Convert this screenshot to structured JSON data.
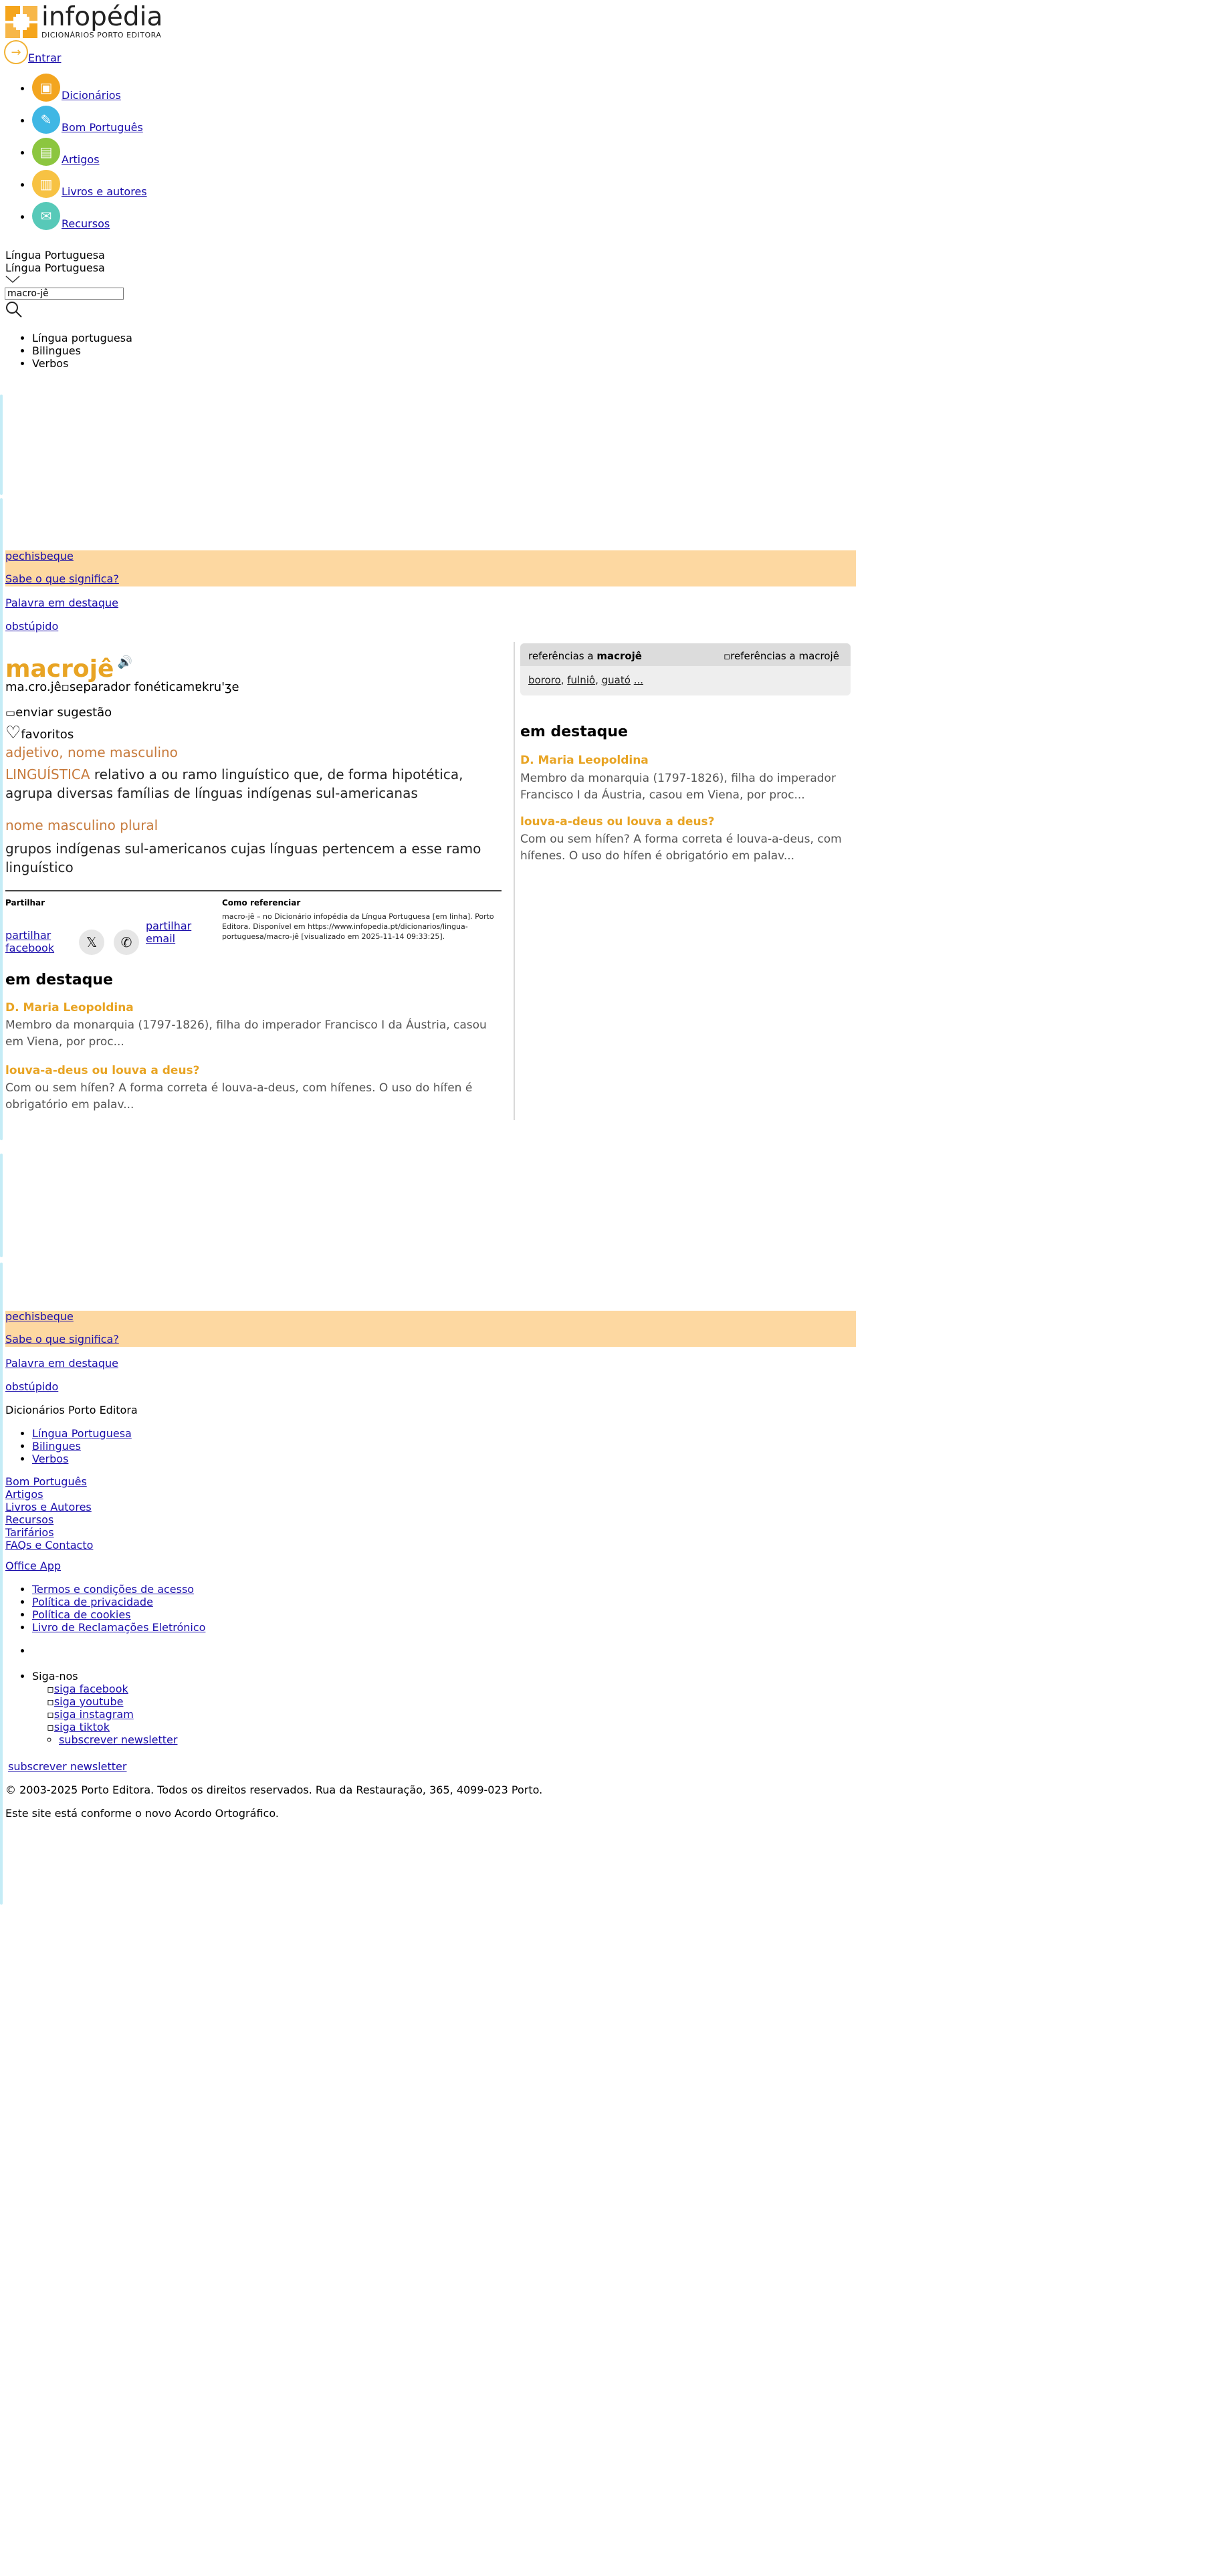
{
  "header": {
    "logo_name": "infopédia",
    "logo_sub": "DICIONÁRIOS PORTO EDITORA",
    "login_label": "Entrar",
    "nav": [
      {
        "label": "Dicionários",
        "color": "#f3a51f",
        "icon": "book-icon"
      },
      {
        "label": "Bom Português",
        "color": "#3fb7e4",
        "icon": "pen-icon"
      },
      {
        "label": "Artigos",
        "color": "#8cc63f",
        "icon": "document-icon"
      },
      {
        "label": "Livros e autores",
        "color": "#f7c243",
        "icon": "books-icon"
      },
      {
        "label": "Recursos",
        "color": "#57c9b8",
        "icon": "resources-icon"
      }
    ],
    "lang_selected": "Língua Portuguesa",
    "lang_selected_2": "Língua Portuguesa",
    "search_value": "macro-jê",
    "search_options": [
      "Língua portuguesa",
      "Bilingues",
      "Verbos"
    ]
  },
  "promo": {
    "word": "pechisbeque",
    "question": "Sabe o que significa?",
    "featured_label": "Palavra em destaque",
    "featured_word": "obstúpido"
  },
  "entry": {
    "headword": "macrojê",
    "syllables": "ma.cro.jê",
    "sep_alt": "separador fonética",
    "phonetic": "mɐkru'ʒe",
    "suggest_label": "enviar sugestão",
    "favorites_label": "favoritos",
    "gram1": "adjetivo, nome masculino",
    "area": "LINGUÍSTICA",
    "def1": "relativo a ou ramo linguístico que, de forma hipotética, agrupa diversas famílias de línguas indígenas sul-americanas",
    "gram2": "nome masculino plural",
    "def2": "grupos indígenas sul-americanos cujas línguas pertencem a esse ramo linguístico",
    "share_label": "Partilhar",
    "share_facebook": "partilhar facebook",
    "share_email": "partilhar email",
    "cite_title": "Como referenciar",
    "cite_text": "macro-jê – no Dicionário infopédia da Língua Portuguesa [em linha]. Porto Editora. Disponível em https://www.infopedia.pt/dicionarios/lingua-portuguesa/macro-jê [visualizado em 2025-11-14 09:33:25]."
  },
  "destaque": {
    "title": "em destaque",
    "items": [
      {
        "heading": "D. Maria Leopoldina",
        "text": "Membro da monarquia (1797-1826), filha do imperador Francisco I da Áustria, casou em Viena, por proc..."
      },
      {
        "heading": "louva-a-deus ou louva a deus?",
        "text": "Com ou sem hífen? A forma correta é louva-a-deus, com hífenes. O uso do hífen é obrigatório em palav..."
      }
    ],
    "text_alt_1": "Membro da monarquia (1797-1826), filha do imperador Francisco I da Áustria, casou em Viena, por proc...",
    "text_alt_2": "Com ou sem hífen? A forma correta é louva-a-deus, com hífenes. O uso do hífen é obrigatório em palav..."
  },
  "refs": {
    "label_prefix": "referências a",
    "label_word": "macrojê",
    "img_alt": "referências a macrojê",
    "links": [
      "bororo",
      "fulniô",
      "guató",
      "..."
    ]
  },
  "footer": {
    "dict_title": "Dicionários Porto Editora",
    "dict_links": [
      "Língua Portuguesa",
      "Bilingues",
      "Verbos"
    ],
    "links": [
      "Bom Português",
      "Artigos",
      "Livros e Autores",
      "Recursos",
      "Tarifários",
      "FAQs e Contacto"
    ],
    "office_app": "Office App",
    "legal": [
      "Termos e condições de acesso",
      "Política de privacidade",
      "Política de cookies",
      "Livro de Reclamações Eletrónico"
    ],
    "follow": "Siga-nos",
    "social": [
      "siga facebook",
      "siga youtube",
      "siga instagram",
      "siga tiktok"
    ],
    "newsletter": "subscrever newsletter",
    "newsletter2": "subscrever newsletter",
    "copyright": "© 2003-2025 Porto Editora. Todos os direitos reservados. Rua da Restauração, 365, 4099-023 Porto.",
    "acordo": "Este site está conforme o novo Acordo Ortográfico."
  }
}
